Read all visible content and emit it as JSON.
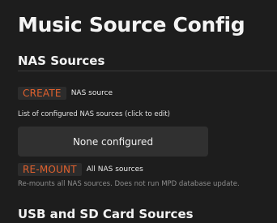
{
  "page": {
    "title": "Music Source Config"
  },
  "nas_section": {
    "title": "NAS Sources",
    "create_button": "CREATE",
    "create_label": "NAS source",
    "list_hint": "List of configured NAS sources (click to edit)",
    "empty_state": "None configured",
    "remount_button": "RE-MOUNT",
    "remount_label": "All NAS sources",
    "remount_note": "Re-mounts all NAS sources. Does not run MPD database update."
  },
  "usb_section": {
    "title": "USB and SD Card Sources"
  },
  "colors": {
    "background": "#1d1d1d",
    "button_background": "#2c2c2c",
    "accent": "#e0612e",
    "panel": "#303030",
    "muted_text": "#8d8d8d"
  }
}
